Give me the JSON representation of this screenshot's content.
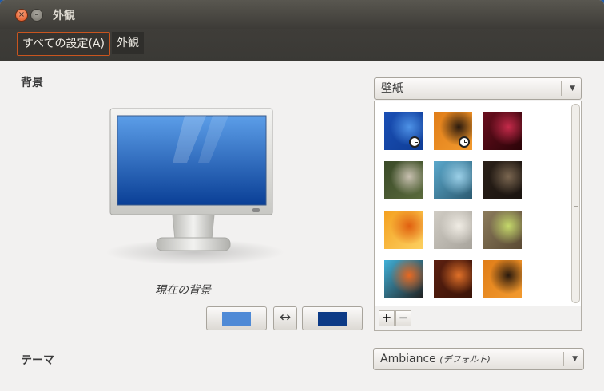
{
  "window": {
    "title": "外観",
    "close_glyph": "×",
    "minimize_glyph": "–"
  },
  "toolbar": {
    "all_settings": "すべての設定(A)",
    "current": "外観"
  },
  "background": {
    "section_label": "背景",
    "current_label": "現在の背景",
    "primary_color": "#4f8ad6",
    "secondary_color": "#0c3a86",
    "swap_glyph": "↔"
  },
  "source_select": {
    "value": "壁紙",
    "arrow": "▼"
  },
  "gallery": {
    "add": "+",
    "remove": "−",
    "items": [
      {
        "name": "blue-stripes",
        "colors": [
          "#1a4fb5",
          "#4e92e6",
          "#0f3d96"
        ],
        "clock": true
      },
      {
        "name": "orange-dark",
        "colors": [
          "#e07d18",
          "#2a1a0e",
          "#f29a2e"
        ],
        "clock": true
      },
      {
        "name": "red-flower",
        "colors": [
          "#6a0e1e",
          "#c42a4a",
          "#2a0408"
        ],
        "clock": false
      },
      {
        "name": "white-flowers",
        "colors": [
          "#3a4a28",
          "#c8c0b0",
          "#5a6a3c"
        ],
        "clock": false
      },
      {
        "name": "birds-sky",
        "colors": [
          "#5aa8cc",
          "#9cd0e8",
          "#2c5a70"
        ],
        "clock": false
      },
      {
        "name": "dark-dust",
        "colors": [
          "#2a2018",
          "#7a6650",
          "#1a1410"
        ],
        "clock": false
      },
      {
        "name": "orange-blossom",
        "colors": [
          "#f4a020",
          "#e06010",
          "#fcd060"
        ],
        "clock": false
      },
      {
        "name": "white-feather",
        "colors": [
          "#d0ccc4",
          "#f0ece4",
          "#a8a49c"
        ],
        "clock": false
      },
      {
        "name": "yellow-bloom",
        "colors": [
          "#8c7c5c",
          "#c4d86a",
          "#5a4a34"
        ],
        "clock": false
      },
      {
        "name": "graffiti",
        "colors": [
          "#40b0d8",
          "#e86820",
          "#202020"
        ],
        "clock": false
      },
      {
        "name": "orange-leaf",
        "colors": [
          "#5c2010",
          "#e07028",
          "#3a1408"
        ],
        "clock": false
      },
      {
        "name": "orange-dark-2",
        "colors": [
          "#e07d18",
          "#2a1a0e",
          "#f29a2e"
        ],
        "clock": false
      }
    ]
  },
  "theme": {
    "section_label": "テーマ",
    "value": "Ambiance",
    "value_suffix": "(デフォルト)",
    "arrow": "▼"
  }
}
